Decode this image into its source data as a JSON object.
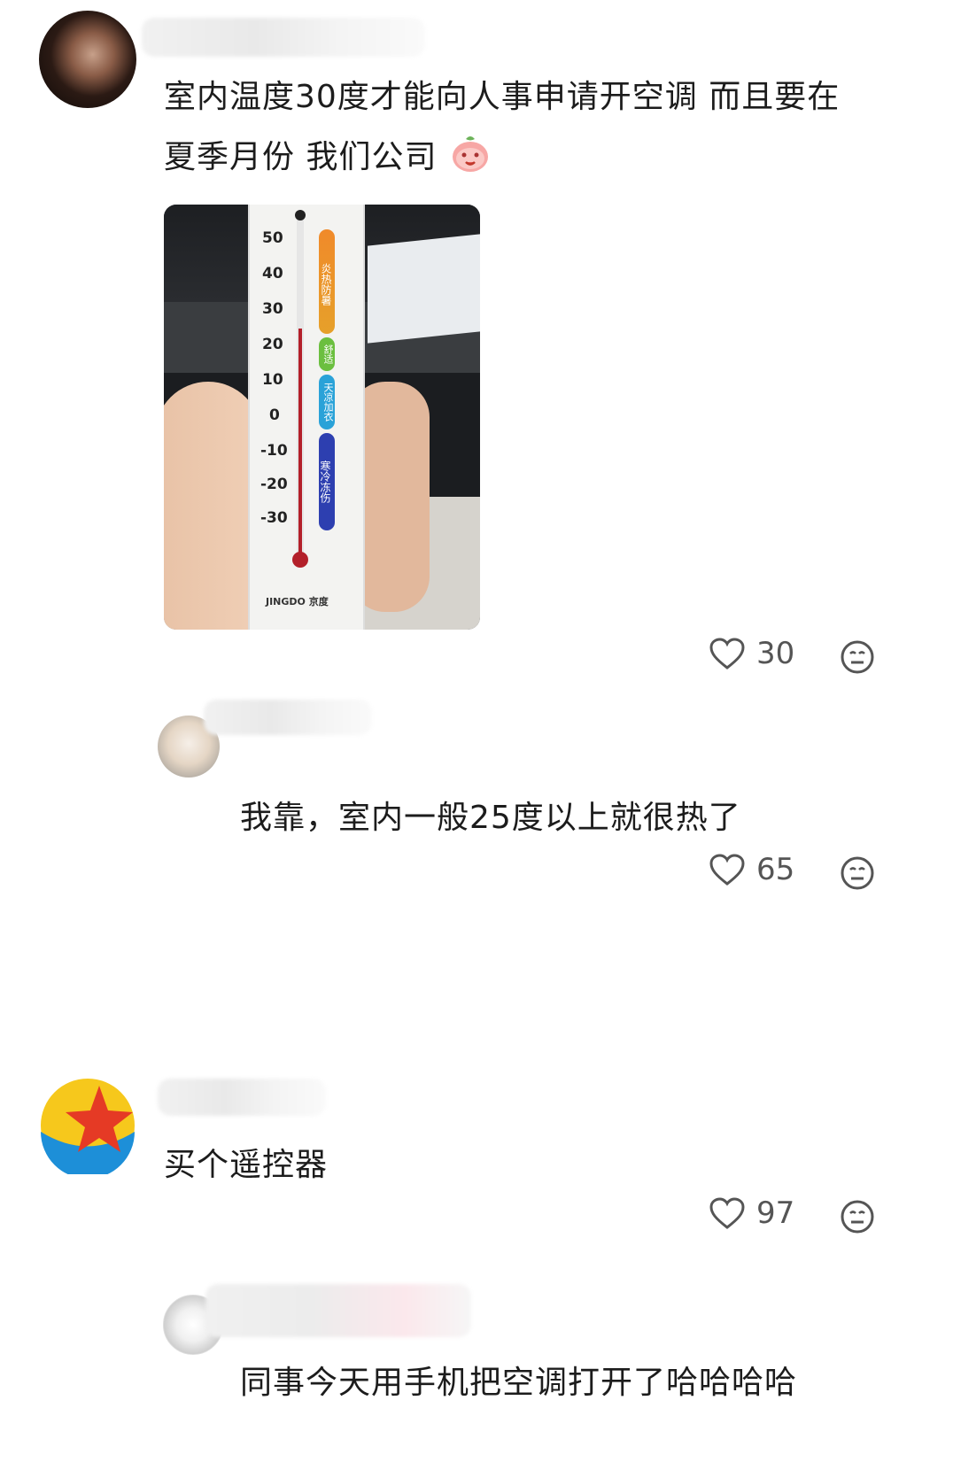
{
  "comments": [
    {
      "text_line1": "室内温度30度才能向人事申请开空调 而且要在",
      "text_line2": "夏季月份 我们公司",
      "likes": "30",
      "image": {
        "thermometer_scale": [
          "50",
          "40",
          "30",
          "20",
          "10",
          "0",
          "-10",
          "-20",
          "-30"
        ],
        "zones": [
          {
            "label": "炎热防暑",
            "color": "#e8772a"
          },
          {
            "label": "舒适",
            "color": "#6bbf3f"
          },
          {
            "label": "天凉加衣",
            "color": "#2aa2d8"
          },
          {
            "label": "寒冷冻伤",
            "color": "#2d3fb0"
          }
        ],
        "brand": "JINGDO 京度"
      }
    },
    {
      "text": "我靠，室内一般25度以上就很热了",
      "likes": "65",
      "reply": true
    },
    {
      "text": "买个遥控器",
      "likes": "97"
    },
    {
      "text": "同事今天用手机把空调打开了哈哈哈哈",
      "reply": true
    }
  ],
  "icons": {
    "like": "heart-outline-icon",
    "reaction": "meh-face-icon",
    "inline_emoji": "peach-emoji"
  },
  "colors": {
    "text": "#1c1c1c",
    "meta": "#555555",
    "star_avatar_red": "#e53a25",
    "star_avatar_yellow": "#f6c81c",
    "star_avatar_blue": "#1d8fd8"
  }
}
